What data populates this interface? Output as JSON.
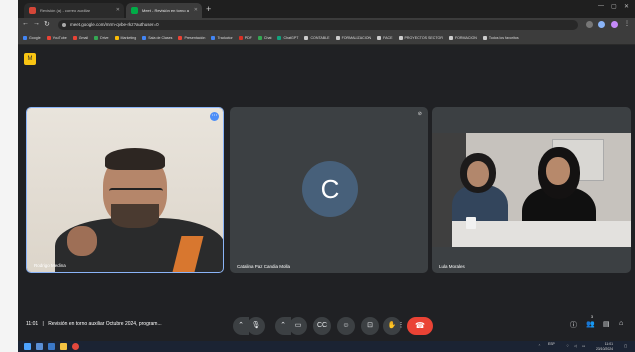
{
  "browser": {
    "tabs": [
      {
        "label": "Revisión (a) - correo auxiliar",
        "active": false
      },
      {
        "label": "Meet - Revisión en torno a",
        "active": true
      }
    ],
    "url": "meet.google.com/mrm-qvbe-rkz?authuser=0",
    "bookmarks": [
      "Google",
      "YouTube",
      "Gmail",
      "Drive",
      "Marketing",
      "Sala de Clases",
      "Presentación",
      "Traductor",
      "PDF",
      "Chat",
      "ChatGPT",
      "CONTABLE",
      "FORMALIZACION",
      "FACE",
      "PROYECTOS SECTOR",
      "FORMACION",
      "Todos los favoritos"
    ]
  },
  "meet": {
    "logo": "M",
    "participants": [
      {
        "name": "Rodrigo Medina",
        "kind": "video"
      },
      {
        "name": "Catalina Paz Candia Molla",
        "kind": "avatar",
        "initial": "C"
      },
      {
        "name": "Lula Morales",
        "kind": "video"
      }
    ],
    "clock": "11:01",
    "separator": "|",
    "meeting_title": "Revisión en torno auxiliar Octubre 2024, program...",
    "controls": [
      "mic-icon",
      "chevron-up-icon",
      "camera-icon",
      "captions-icon",
      "emoji-icon",
      "present-icon",
      "raise-hand-icon",
      "more-icon"
    ],
    "participant_count": "3"
  },
  "taskbar": {
    "time": "11:01",
    "date": "23/10/2024",
    "lang": "ESP"
  },
  "colors": {
    "meet_bg": "#202124",
    "tile_bg": "#3c4043",
    "end_call": "#ea4335",
    "avatar_bg": "#47607a",
    "active_border": "#8ab4f8"
  }
}
